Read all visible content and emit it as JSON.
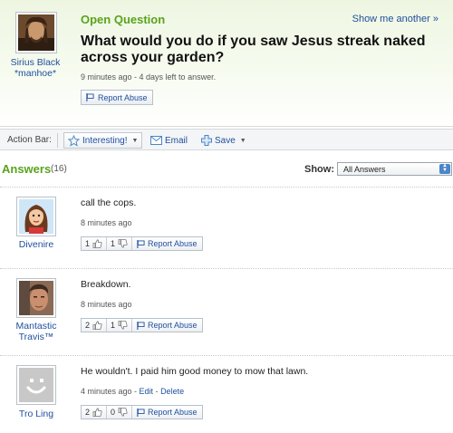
{
  "question": {
    "status": "Open Question",
    "show_another": "Show me another »",
    "title": "What would you do if you saw Jesus streak naked across your garden?",
    "meta": "9 minutes ago - 4 days left to answer.",
    "report_label": "Report Abuse",
    "asker_name": "Sirius Black",
    "asker_nickname": "*manhoe*"
  },
  "action_bar": {
    "label": "Action Bar:",
    "interesting": "Interesting!",
    "email": "Email",
    "save": "Save"
  },
  "answers_header": {
    "title": "Answers",
    "count": "(16)",
    "show_label": "Show:",
    "show_value": "All Answers"
  },
  "answers": [
    {
      "author": "Divenire",
      "text": "call the cops.",
      "time": "8 minutes ago",
      "thumbs_up": "1",
      "thumbs_down": "1",
      "report_label": "Report Abuse"
    },
    {
      "author": "Mantastic Travis™",
      "text": "Breakdown.",
      "time": "8 minutes ago",
      "thumbs_up": "2",
      "thumbs_down": "1",
      "report_label": "Report Abuse"
    },
    {
      "author": "Tro Ling",
      "text": "He wouldn't. I paid him good money to mow that lawn.",
      "time": "4 minutes ago",
      "edit_label": "Edit",
      "delete_label": "Delete",
      "thumbs_up": "2",
      "thumbs_down": "0",
      "report_label": "Report Abuse"
    }
  ],
  "colors": {
    "accent_green": "#5aa31c",
    "link_blue": "#1f4f9e"
  }
}
